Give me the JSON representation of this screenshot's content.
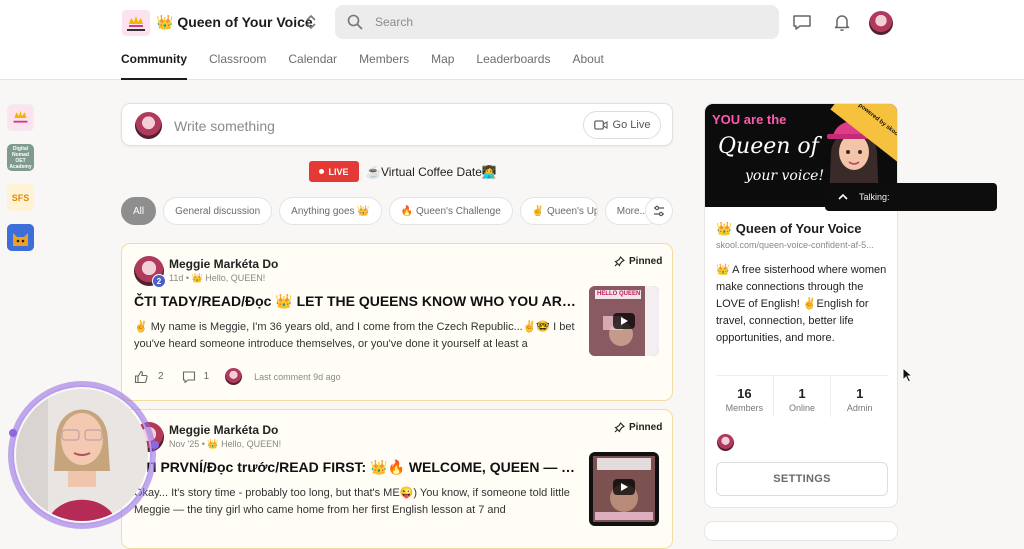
{
  "header": {
    "logo_text": "Queen of Your Voice",
    "group_name": "👑 Queen of Your Voice",
    "search_placeholder": "Search"
  },
  "nav": {
    "tabs": [
      {
        "label": "Community",
        "active": true
      },
      {
        "label": "Classroom",
        "active": false
      },
      {
        "label": "Calendar",
        "active": false
      },
      {
        "label": "Members",
        "active": false
      },
      {
        "label": "Map",
        "active": false
      },
      {
        "label": "Leaderboards",
        "active": false
      },
      {
        "label": "About",
        "active": false
      }
    ]
  },
  "sidebar": {
    "groups": [
      {
        "name": "queen-of-your-voice-group"
      },
      {
        "name": "digital-nomad-group",
        "text": "Digital Nomad OET Academy"
      },
      {
        "name": "sfs-group",
        "text": "SFS"
      },
      {
        "name": "cat-group"
      }
    ]
  },
  "composer": {
    "placeholder": "Write something",
    "go_live_label": "Go Live"
  },
  "live_event": {
    "badge": "LIVE",
    "title": "☕Virtual Coffee Date👩‍💻"
  },
  "filters": {
    "chips": [
      "All",
      "General discussion",
      "Anything goes 👑",
      "🔥 Queen's Challenge",
      "✌ Queen's Upd",
      "More..."
    ]
  },
  "posts": [
    {
      "author": "Meggie Markéta Do",
      "level": "2",
      "meta": "11d • 👑 Hello, QUEEN!",
      "pinned_label": "Pinned",
      "title": "ČTI TADY/READ/Đọc 👑 LET THE QUEENS KNOW WHO YOU ARE 👑",
      "body": "✌ My name is Meggie, I'm 36 years old, and I come from the Czech Republic...✌🤓 I bet you've heard someone introduce themselves, or you've done it yourself at least a",
      "likes": "2",
      "comments": "1",
      "last_comment": "Last comment 9d ago",
      "thumb_text": "HELLO QUEEN"
    },
    {
      "author": "Meggie Markéta Do",
      "meta": "Nov '25 • 👑 Hello, QUEEN!",
      "pinned_label": "Pinned",
      "title": "ČTI PRVNÍ/Đọc trước/READ FIRST: 👑🔥 WELCOME, QUEEN — YOU ...",
      "body": "Okay... It's story time - probably too long, but that's ME😜) You know, if someone told little Meggie — the tiny girl who came home from her first English lesson at 7 and"
    }
  ],
  "about_card": {
    "banner_you": "YOU are the",
    "banner_line1": "Queen of",
    "banner_line2": "your voice!",
    "powered_by": "powered by skool",
    "title": "👑 Queen of Your Voice",
    "url": "skool.com/queen-voice-confident-af-5...",
    "description": "👑 A free sisterhood where women make connections through the LOVE of English! ✌English for travel, connection, better life opportunities, and more.",
    "stats": [
      {
        "value": "16",
        "label": "Members"
      },
      {
        "value": "1",
        "label": "Online"
      },
      {
        "value": "1",
        "label": "Admin"
      }
    ],
    "settings_label": "SETTINGS"
  },
  "talking_popup": {
    "label": "Talking:"
  },
  "colors": {
    "live_red": "#e53935",
    "pinned_border": "#f2dca0",
    "level_badge": "#4b5fc6",
    "banner_pink": "#ff5ab0",
    "video_ring": "#8f66e0"
  }
}
